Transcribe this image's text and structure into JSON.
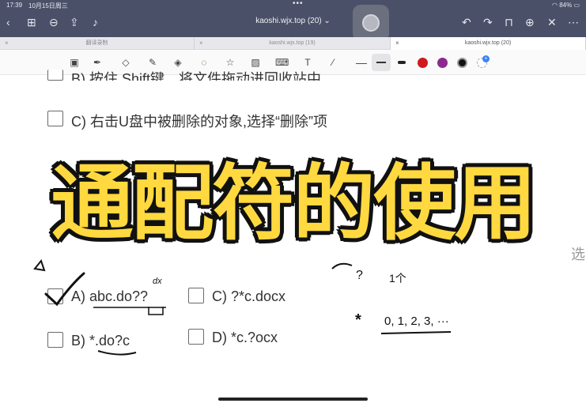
{
  "status_bar": {
    "time": "17:39",
    "date": "10月15日周三",
    "battery": "84%"
  },
  "nav": {
    "title": "kaoshi.wjx.top (20) ⌄"
  },
  "tabs": [
    {
      "label": "翻译录制"
    },
    {
      "label": "kaoshi.wjx.top (19)"
    },
    {
      "label": "kaoshi.wjx.top (20)"
    }
  ],
  "options_upper": {
    "b_partial": "B) 按住 Shift键，将文件拖动进回收站中",
    "c": "C) 右击U盘中被删除的对象,选择“删除”项"
  },
  "overlay": {
    "title": "通配符的使用"
  },
  "options_lower": {
    "a": "A) abc.do??",
    "b": "B) *.do?c",
    "c": "C) ?*c.docx",
    "d": "D) *c.?ocx"
  },
  "right_edge_text": "选",
  "handwriting": {
    "q_mark": "?",
    "one_char": "1个",
    "star": "*",
    "sequence": "0, 1, 2, 3, ···",
    "dx": "dx"
  },
  "colors": {
    "topbar": "#4a5068",
    "title_fill": "#ffd93f",
    "red": "#d0191c",
    "purple": "#8c2a8e",
    "black": "#111111"
  }
}
